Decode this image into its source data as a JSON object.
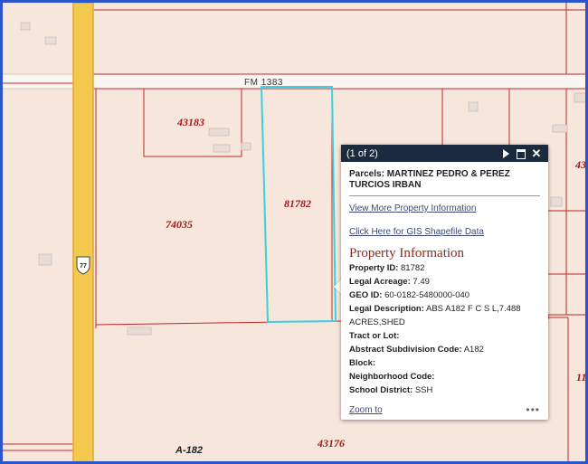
{
  "map": {
    "road_label": "FM 1383",
    "highway_shield": "77",
    "abstract_label": "A-182",
    "parcel_labels": [
      "43183",
      "81782",
      "74035",
      "43176",
      "43",
      "11"
    ]
  },
  "popup": {
    "count": "(1 of 2)",
    "title": "Parcels: MARTINEZ PEDRO & PEREZ TURCIOS IRBAN",
    "link_property": "View More Property Information",
    "link_gis": "Click Here for GIS Shapefile Data",
    "section_title": "Property Information",
    "fields": [
      {
        "label": "Property ID:",
        "value": "81782"
      },
      {
        "label": "Legal Acreage:",
        "value": "7.49"
      },
      {
        "label": "GEO ID:",
        "value": "60-0182-5480000-040"
      },
      {
        "label": "Legal Description:",
        "value": "ABS A182 F C S L,7.488 ACRES,SHED"
      },
      {
        "label": "Tract or Lot:",
        "value": ""
      },
      {
        "label": "Abstract Subdivision Code:",
        "value": "A182"
      },
      {
        "label": "Block:",
        "value": ""
      },
      {
        "label": "Neighborhood Code:",
        "value": ""
      },
      {
        "label": "School District:",
        "value": "SSH"
      }
    ],
    "zoom_label": "Zoom to",
    "more_label": "•••"
  },
  "colors": {
    "parcel_line": "#c0282a",
    "selected_outline": "#39d1e0",
    "highway": "#f2c94c",
    "popup_header": "#1b2a3f"
  }
}
